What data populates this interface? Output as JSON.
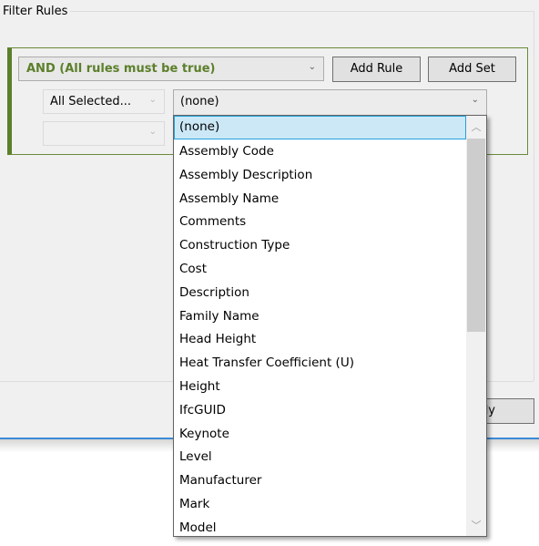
{
  "group": {
    "title": "Filter Rules"
  },
  "ruleset": {
    "logic_value": "AND (All rules must be true)",
    "add_rule_label": "Add Rule",
    "add_set_label": "Add Set",
    "accent_color": "#5b7f2a"
  },
  "rule": {
    "category_value": "All Selected...",
    "category2_value": "",
    "parameter_value": "(none)"
  },
  "dropdown": {
    "selected": "(none)",
    "items": [
      "(none)",
      "Assembly Code",
      "Assembly Description",
      "Assembly Name",
      "Comments",
      "Construction Type",
      "Cost",
      "Description",
      "Family Name",
      "Head Height",
      "Heat Transfer Coefficient (U)",
      "Height",
      "IfcGUID",
      "Keynote",
      "Level",
      "Manufacturer",
      "Mark",
      "Model"
    ],
    "scroll_position": 0
  },
  "footer": {
    "apply_label": "Apply"
  },
  "icons": {
    "chevron_down": "⌄",
    "chevron_up": "︿",
    "scroll_down": "﹀"
  }
}
